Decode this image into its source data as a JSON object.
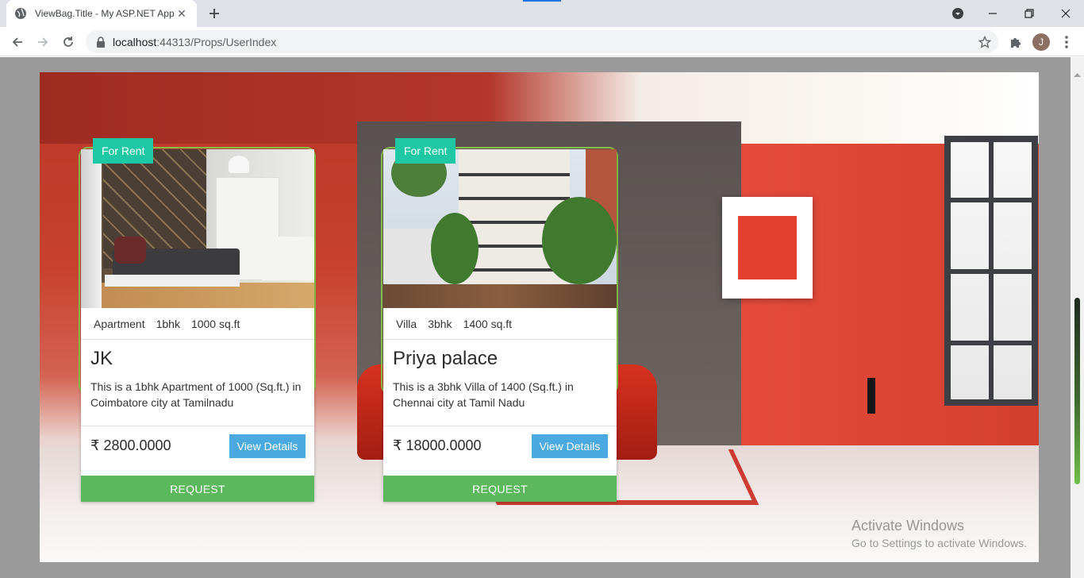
{
  "browser": {
    "tab_title": "ViewBag.Title - My ASP.NET Appl",
    "url_host": "localhost",
    "url_path": ":44313/Props/UserIndex",
    "profile_initial": "J"
  },
  "listings": [
    {
      "badge": "For Rent",
      "type": "Apartment",
      "bhk": "1bhk",
      "area": "1000 sq.ft",
      "title": "JK",
      "description": "This is a 1bhk Apartment of 1000 (Sq.ft.) in Coimbatore city at Tamilnadu",
      "price": "₹ 2800.0000",
      "details_label": "View Details",
      "request_label": "REQUEST"
    },
    {
      "badge": "For Rent",
      "type": "Villa",
      "bhk": "3bhk",
      "area": "1400 sq.ft",
      "title": "Priya palace",
      "description": "This is a 3bhk Villa of 1400 (Sq.ft.) in Chennai city at Tamil Nadu",
      "price": "₹ 18000.0000",
      "details_label": "View Details",
      "request_label": "REQUEST"
    }
  ],
  "watermark": {
    "line1": "Activate Windows",
    "line2": "Go to Settings to activate Windows."
  },
  "colors": {
    "badge": "#1ec8a5",
    "details_button": "#4aaae0",
    "request_button": "#5cb85c",
    "card_outline": "#8bc34a"
  }
}
